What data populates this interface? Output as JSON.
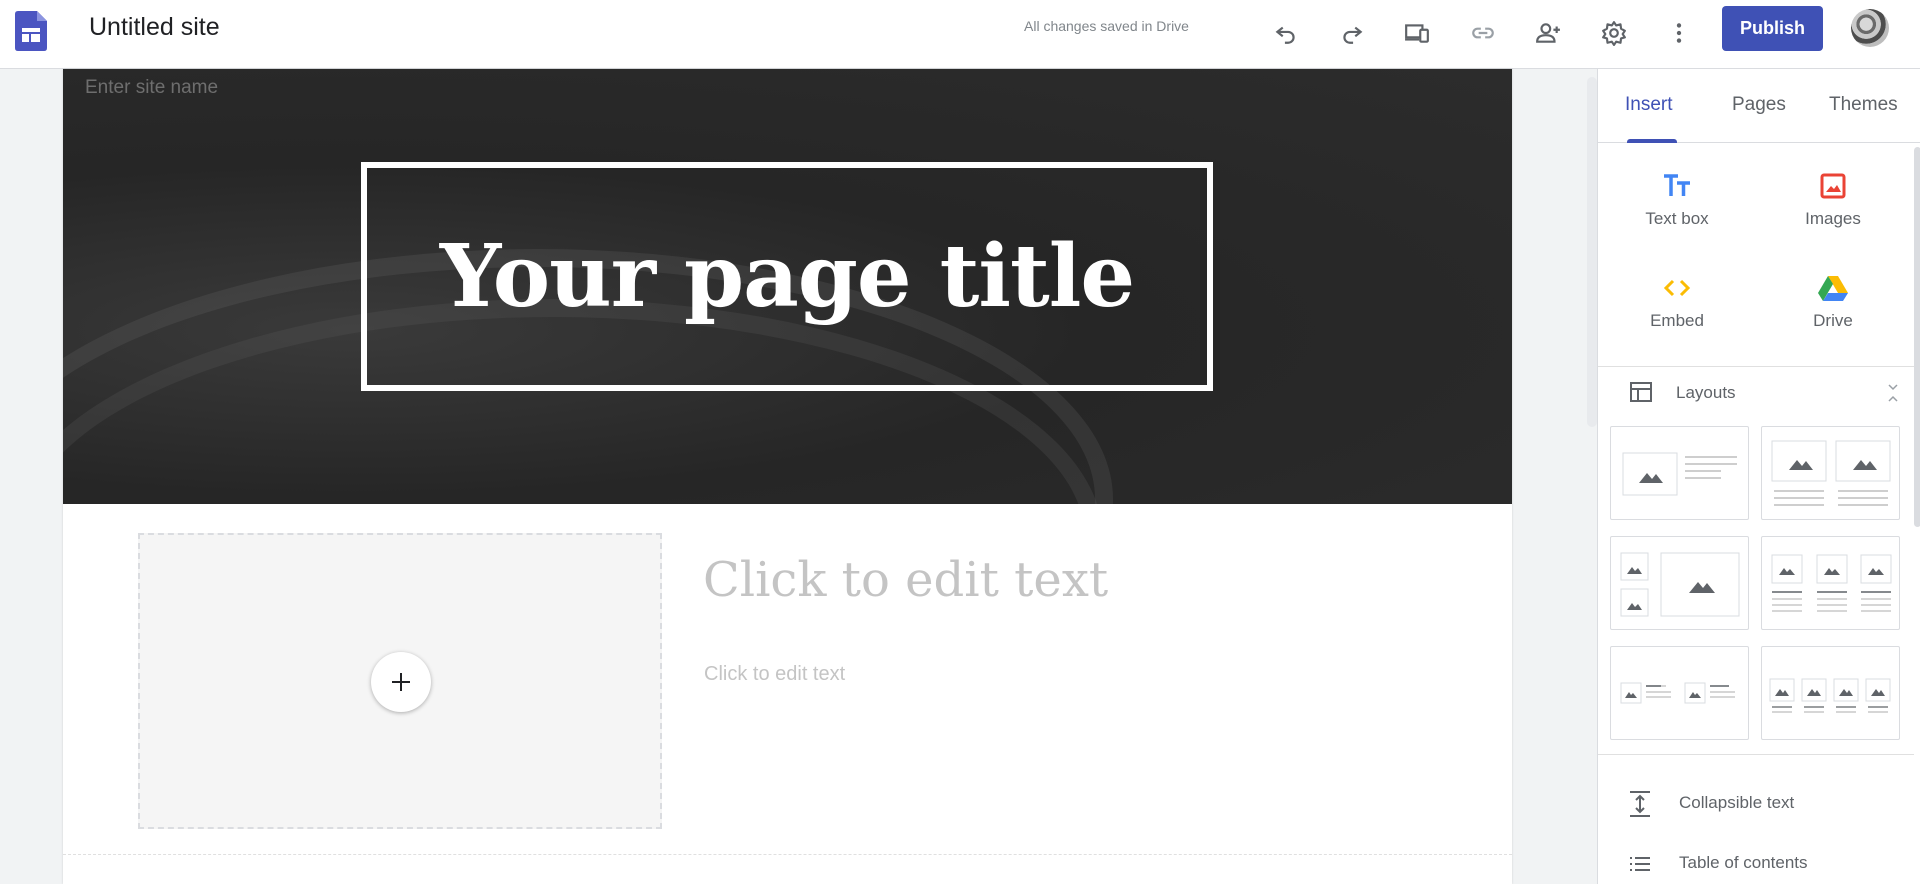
{
  "app": {
    "site_title": "Untitled site",
    "save_status": "All changes saved in Drive",
    "publish_label": "Publish",
    "toolbar_icons": [
      "undo-icon",
      "redo-icon",
      "preview-devices-icon",
      "link-icon",
      "share-person-icon",
      "gear-icon",
      "more-vert-icon"
    ]
  },
  "canvas": {
    "site_name_placeholder": "Enter site name",
    "page_title": "Your page title",
    "heading_placeholder": "Click to edit text",
    "body_placeholder": "Click to edit text"
  },
  "panel": {
    "tabs": [
      {
        "label": "Insert",
        "active": true
      },
      {
        "label": "Pages",
        "active": false
      },
      {
        "label": "Themes",
        "active": false
      }
    ],
    "insert_items": [
      {
        "label": "Text box",
        "icon": "text-box-icon",
        "color": "#4285f4"
      },
      {
        "label": "Images",
        "icon": "image-icon",
        "color": "#ea4335"
      },
      {
        "label": "Embed",
        "icon": "embed-icon",
        "color": "#fbbc04"
      },
      {
        "label": "Drive",
        "icon": "drive-icon",
        "color": "#34a853"
      }
    ],
    "layouts_label": "Layouts",
    "list_items": [
      {
        "label": "Collapsible text",
        "icon": "collapsible-icon"
      },
      {
        "label": "Table of contents",
        "icon": "toc-icon"
      }
    ]
  },
  "colors": {
    "accent": "#3f51b5",
    "banner": "#2a2a2a"
  }
}
